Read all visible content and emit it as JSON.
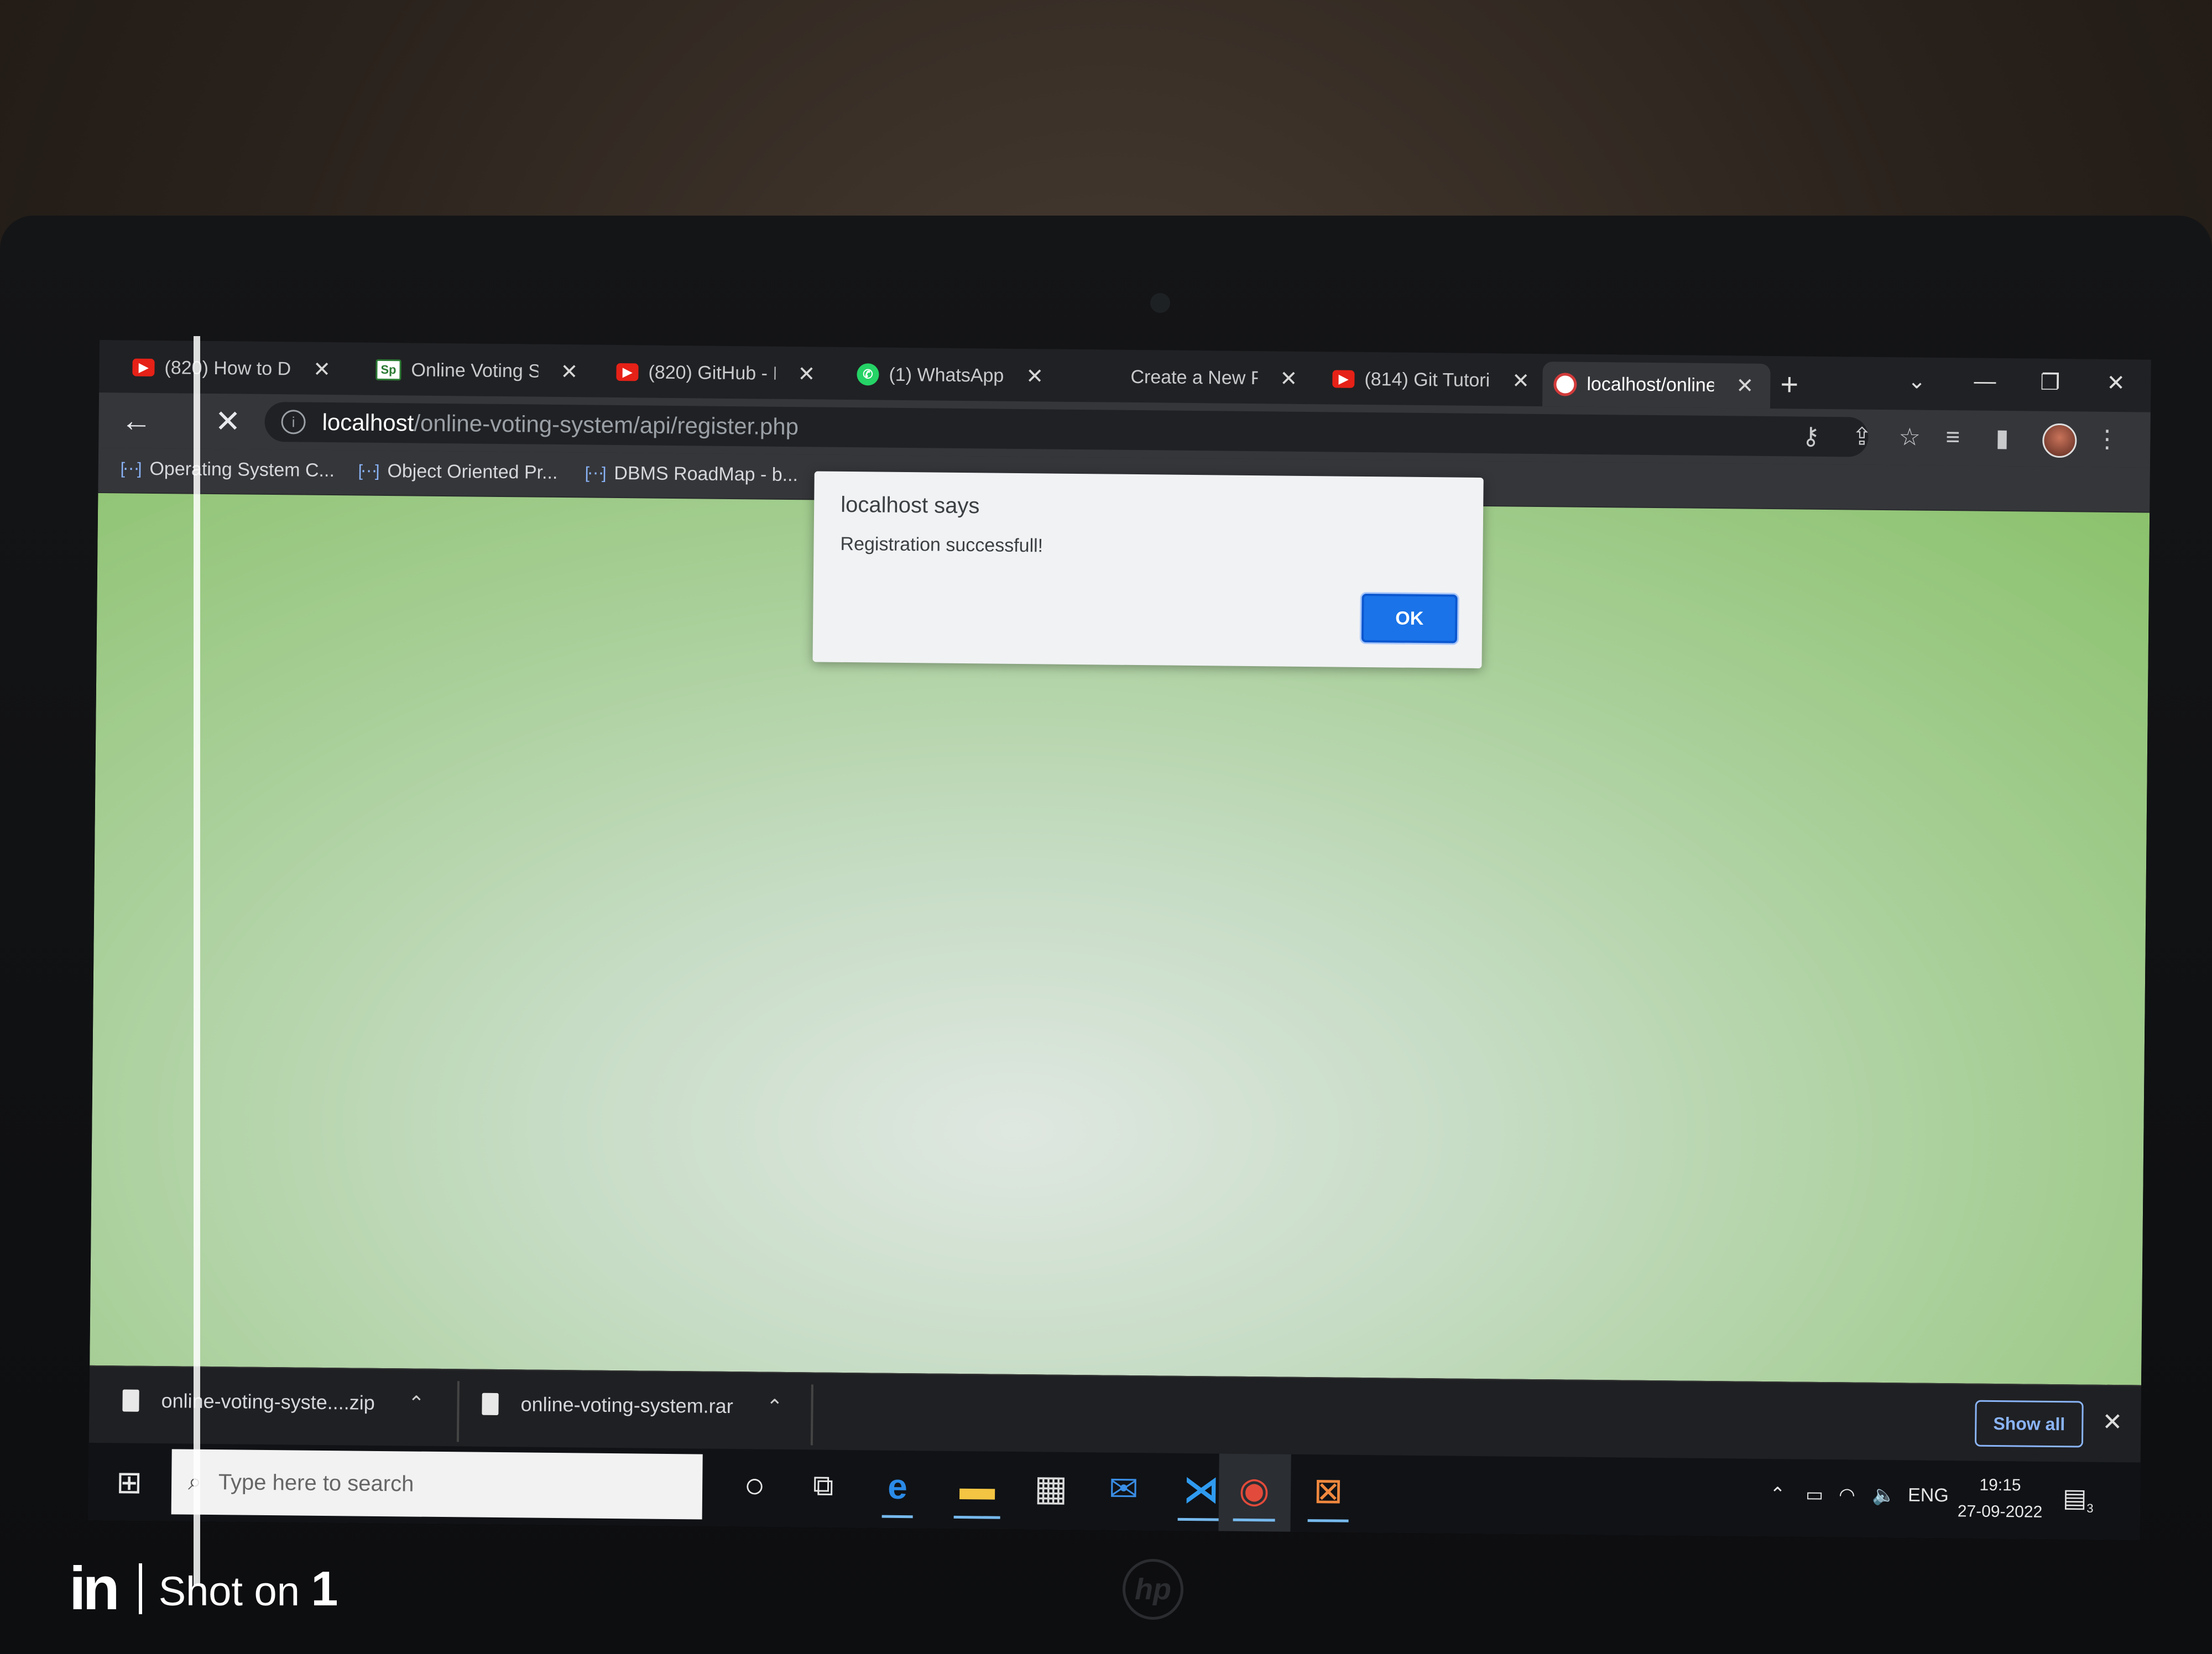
{
  "browser": {
    "tabs": [
      {
        "favicon": "youtube-icon",
        "title": "(820) How to D",
        "active": false
      },
      {
        "favicon": "sp-icon",
        "title": "Online Voting S",
        "active": false
      },
      {
        "favicon": "youtube-icon",
        "title": "(820) GitHub - I",
        "active": false
      },
      {
        "favicon": "whatsapp-icon",
        "title": "(1) WhatsApp",
        "active": false
      },
      {
        "favicon": "none",
        "title": "Create a New F",
        "active": false
      },
      {
        "favicon": "youtube-icon",
        "title": "(814) Git Tutori",
        "active": false
      },
      {
        "favicon": "localhost-icon",
        "title": "localhost/online",
        "active": true
      }
    ],
    "address": {
      "host": "localhost",
      "path": "/online-voting-system/api/register.php"
    },
    "bookmarks": [
      {
        "label": "Operating System C..."
      },
      {
        "label": "Object Oriented Pr..."
      },
      {
        "label": "DBMS RoadMap - b..."
      }
    ]
  },
  "dialog": {
    "title": "localhost says",
    "message": "Registration successfull!",
    "ok_label": "OK"
  },
  "downloads": {
    "items": [
      {
        "name": "online-voting-syste....zip"
      },
      {
        "name": "online-voting-system.rar"
      }
    ],
    "show_all_label": "Show all"
  },
  "taskbar": {
    "search_placeholder": "Type here to search",
    "language": "ENG",
    "time": "19:15",
    "date": "27-09-2022",
    "notification_count": "3"
  },
  "watermark": {
    "brand": "in",
    "text": "Shot on",
    "number": "1"
  },
  "colors": {
    "dialog_ok": "#1a73e8",
    "page_bg_edge": "#8bc26c",
    "page_bg_center": "#dfe7e1"
  }
}
